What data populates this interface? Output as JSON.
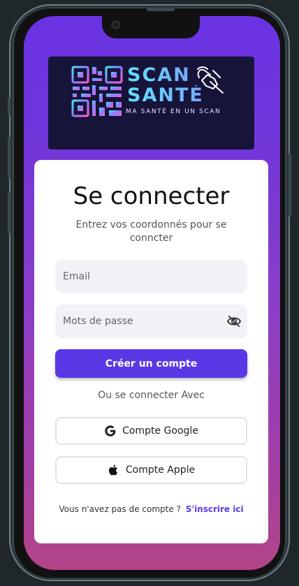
{
  "logo": {
    "line1": "SCAN",
    "line2": "SANTÉ",
    "tagline": "MA SANTÉ EN UN SCAN"
  },
  "login": {
    "title": "Se connecter",
    "subtitle": "Entrez vos coordonnés pour se conncter",
    "email_placeholder": "Email",
    "password_placeholder": "Mots de passe",
    "create_button": "Créer un compte",
    "or_text": "Ou se  connecter Avec",
    "google_button": "Compte  Google",
    "apple_button": "Compte Apple",
    "no_account_text": "Vous n'avez pas de compte ?",
    "signup_link": "S'inscrire ici"
  },
  "colors": {
    "primary": "#5b38e6",
    "gradient_top": "#6a33e3",
    "gradient_bottom": "#b34488",
    "logo_bg": "#17143a"
  }
}
